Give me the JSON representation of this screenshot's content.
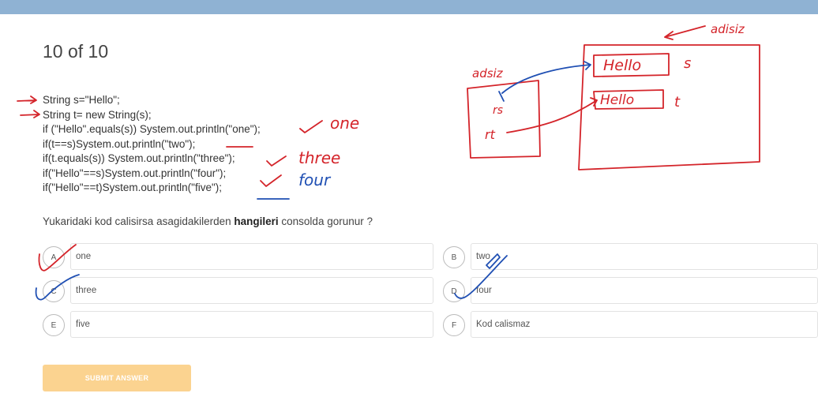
{
  "header": {
    "counter": "10 of 10"
  },
  "code": {
    "lines": [
      "String s=\"Hello\";",
      "String t= new String(s);",
      "if (\"Hello\".equals(s)) System.out.println(\"one\");",
      "if(t==s)System.out.println(\"two\");",
      "if(t.equals(s)) System.out.println(\"three\");",
      "if(\"Hello\"==s)System.out.println(\"four\");",
      "if(\"Hello\"==t)System.out.println(\"five\");"
    ]
  },
  "question": {
    "prefix": "Yukaridaki kod calisirsa asagidakilerden ",
    "bold": "hangileri",
    "suffix": " consolda gorunur ?"
  },
  "options": [
    {
      "letter": "A",
      "text": "one"
    },
    {
      "letter": "B",
      "text": "two"
    },
    {
      "letter": "C",
      "text": "three"
    },
    {
      "letter": "D",
      "text": "four"
    },
    {
      "letter": "E",
      "text": "five"
    },
    {
      "letter": "F",
      "text": "Kod calismaz"
    }
  ],
  "submit": {
    "label": "SUBMIT ANSWER"
  },
  "annotations": {
    "notes": [
      "one",
      "three",
      "four"
    ],
    "diagram": {
      "heap_label": "adisiz",
      "stack_label": "adsiz",
      "box_hello_1": "Hello",
      "box_hello_2": "Hello",
      "var_s": "s",
      "var_t": "t",
      "ref_s": "rs",
      "ref_t": "rt"
    }
  },
  "colors": {
    "ink_red": "#d4242a",
    "ink_blue": "#1f4fb3",
    "submit_bg": "#fbd390",
    "top_bar": "#8fb2d3"
  }
}
